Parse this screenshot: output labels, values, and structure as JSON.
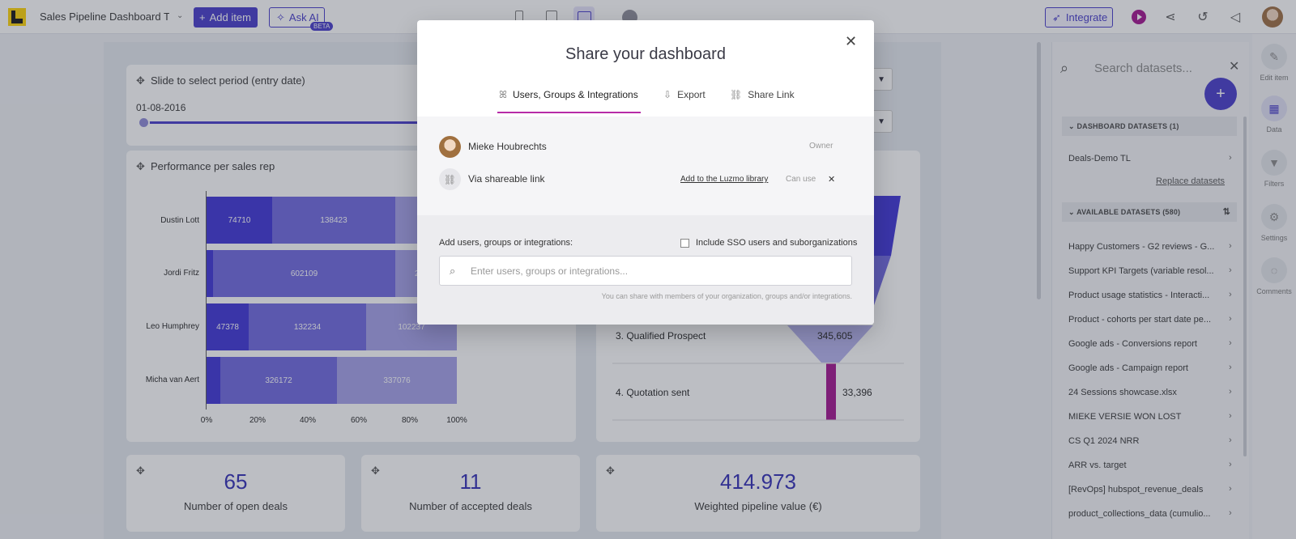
{
  "topbar": {
    "title": "Sales Pipeline Dashboard T...",
    "add_item": "Add item",
    "ask_ai": "Ask AI",
    "beta": "BETA",
    "integrate": "Integrate"
  },
  "dashboard": {
    "slider": {
      "title": "Slide to select period (entry date)",
      "date": "01-08-2016"
    },
    "performance": {
      "title": "Performance per sales rep",
      "reps": [
        {
          "name": "Dustin Lott",
          "segments": [
            "74710",
            "138423",
            ""
          ]
        },
        {
          "name": "Jordi Fritz",
          "segments": [
            "",
            "602109",
            "2"
          ]
        },
        {
          "name": "Leo Humphrey",
          "segments": [
            "47378",
            "132234",
            "102237"
          ]
        },
        {
          "name": "Micha van Aert",
          "segments": [
            "",
            "326172",
            "337076"
          ]
        }
      ],
      "ticks": [
        "0%",
        "20%",
        "40%",
        "60%",
        "80%",
        "100%"
      ]
    },
    "funnel": {
      "stages": [
        {
          "label": "3. Qualified Prospect",
          "value": "345,605"
        },
        {
          "label": "4. Quotation sent",
          "value": "33,396"
        }
      ]
    },
    "kpis": [
      {
        "value": "65",
        "label": "Number of open deals"
      },
      {
        "value": "11",
        "label": "Number of accepted deals"
      },
      {
        "value": "414.973",
        "label": "Weighted pipeline value (€)"
      }
    ]
  },
  "data_panel": {
    "search_placeholder": "Search datasets...",
    "dashboard_datasets_header": "DASHBOARD DATASETS (1)",
    "dashboard_datasets": [
      "Deals-Demo TL"
    ],
    "replace_link": "Replace datasets",
    "available_header": "AVAILABLE DATASETS (580)",
    "available": [
      "Happy Customers - G2 reviews - G...",
      "Support KPI Targets (variable resol...",
      "Product usage statistics - Interacti...",
      "Product - cohorts per start date pe...",
      "Google ads - Conversions report",
      "Google ads - Campaign report",
      "24 Sessions showcase.xlsx",
      "MIEKE VERSIE WON LOST",
      "CS Q1 2024 NRR",
      "ARR vs. target",
      "[RevOps] hubspot_revenue_deals",
      "product_collections_data (cumulio..."
    ]
  },
  "rail": [
    {
      "label": "Edit item",
      "icon": "edit-icon"
    },
    {
      "label": "Data",
      "icon": "table-icon"
    },
    {
      "label": "Filters",
      "icon": "filter-icon"
    },
    {
      "label": "Settings",
      "icon": "gear-icon"
    },
    {
      "label": "Comments",
      "icon": "comment-icon"
    }
  ],
  "modal": {
    "title": "Share your dashboard",
    "tabs": [
      {
        "label": "Users, Groups & Integrations",
        "icon": "users-icon"
      },
      {
        "label": "Export",
        "icon": "export-icon"
      },
      {
        "label": "Share Link",
        "icon": "link-icon"
      }
    ],
    "owner_name": "Mieke Houbrechts",
    "owner_role": "Owner",
    "link_name": "Via shareable link",
    "add_to_library": "Add to the Luzmo library",
    "link_role": "Can use",
    "add_label": "Add users, groups or integrations:",
    "sso_label": "Include SSO users and suborganizations",
    "invite_placeholder": "Enter users, groups or integrations...",
    "hint": "You can share with members of your organization, groups and/or integrations."
  },
  "colors": {
    "accent": "#4338ca",
    "tab_underline": "#b72ba7",
    "funnel_bar": "#a10f8e"
  }
}
